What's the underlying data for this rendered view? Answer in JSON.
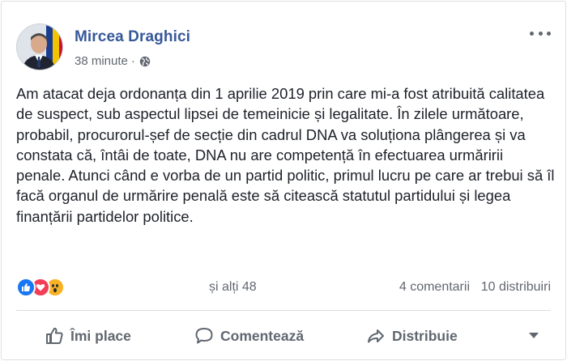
{
  "post": {
    "author": "Mircea Draghici",
    "time": "38 minute",
    "separator": "·",
    "audience_icon": "globe-icon",
    "text": "Am atacat deja ordonanța din 1 aprilie 2019 prin care mi-a fost atribuită calitatea de suspect, sub aspectul lipsei de temeinicie și legalitate. În zilele următoare, probabil, procurorul-șef de secție din cadrul DNA va soluționa plângerea și va constata că, întâi de toate, DNA nu are competență în efectuarea urmăririi penale. Atunci când e vorba de un partid politic, primul lucru pe care ar trebui să îl facă organul de urmărire penală este să citească statutul partidului și legea finanțării partidelor politice."
  },
  "stats": {
    "reaction_icons": [
      "like-icon",
      "love-icon",
      "wow-icon"
    ],
    "others": "și alți 48",
    "comments": "4 comentarii",
    "shares": "10 distribuiri"
  },
  "actions": {
    "like_label": "Îmi place",
    "comment_label": "Comentează",
    "share_label": "Distribuie"
  },
  "colors": {
    "author_link": "#365899",
    "like_blue": "#1877f2",
    "love_red": "#f33e58",
    "wow_yellow": "#f7b125",
    "secondary_text": "#616770"
  }
}
